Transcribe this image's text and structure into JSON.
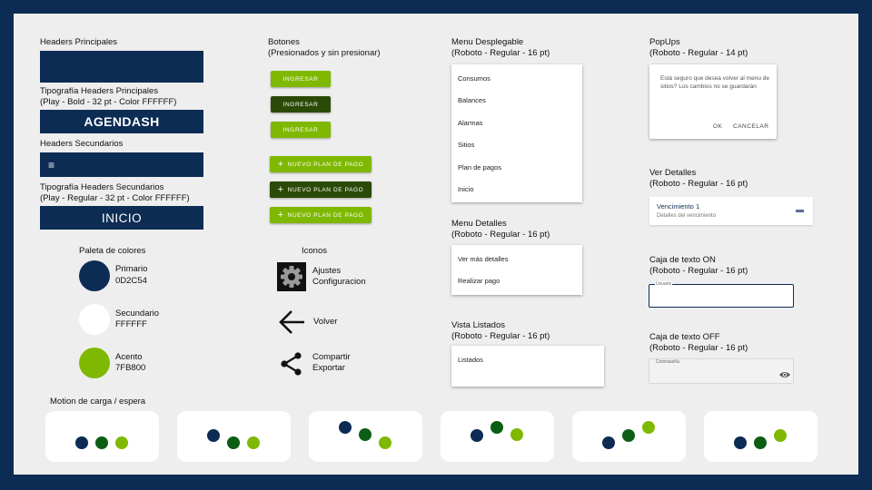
{
  "headers": {
    "principal_label": "Headers Principales",
    "principal_typo_label": "Tipografía Headers Principales\n(Play - Bold - 32 pt - Color FFFFFF)",
    "principal_sample": "AGENDASH",
    "secondary_label": "Headers Secundarios",
    "menu_icon": "≡",
    "secondary_typo_label": "Tipografía Headers Secundarios\n(Play - Regular - 32 pt - Color FFFFFF)",
    "secondary_sample": "INICIO"
  },
  "palette": {
    "label": "Paleta de colores",
    "colors": [
      {
        "name": "Primario",
        "hex_label": "0D2C54",
        "color": "#0D2C54"
      },
      {
        "name": "Secundario",
        "hex_label": "FFFFFF",
        "color": "#FFFFFF"
      },
      {
        "name": "Acento",
        "hex_label": "7FB800",
        "color": "#7FB800"
      }
    ]
  },
  "buttons": {
    "label": "Botones\n(Presionados y sin presionar)",
    "ingresar": "INGRESAR",
    "plus_symbol": "+",
    "nuevo_plan": "NUEVO PLAN DE PAGO"
  },
  "icons": {
    "label": "Iconos",
    "items": [
      {
        "icon": "gear-icon",
        "label": "Ajustes\nConfiguracion"
      },
      {
        "icon": "arrow-left-icon",
        "label": "Volver"
      },
      {
        "icon": "share-icon",
        "label": "Compartir\nExportar"
      }
    ]
  },
  "menu_desplegable": {
    "label": "Menu Desplegable\n(Roboto - Regular - 16 pt)",
    "items": [
      "Consumos",
      "Balances",
      "Alarmas",
      "Sitios",
      "Plan de pagos",
      "Inicio"
    ]
  },
  "menu_detalles": {
    "label": "Menu Detalles\n(Roboto - Regular - 16 pt)",
    "items": [
      "Ver más detalles",
      "Realizar pago"
    ]
  },
  "vista_listados": {
    "label": "Vista Listados\n(Roboto - Regular - 16 pt)",
    "item": "Listados"
  },
  "popups": {
    "label": "PopUps\n(Roboto - Regular - 14 pt)",
    "message": "Está seguro que desea volver al menu de sitios? Los cambios no se guardarán",
    "ok": "OK",
    "cancel": "CANCELAR"
  },
  "ver_detalles": {
    "label": "Ver Detalles\n(Roboto - Regular - 16 pt)",
    "title": "Vencimiento 1",
    "subtitle": "Detalles del vencimiento"
  },
  "caja_on": {
    "label": "Caja de texto ON\n(Roboto - Regular - 16 pt)",
    "field_label": "Usuario"
  },
  "caja_off": {
    "label": "Caja de texto OFF\n(Roboto - Regular - 16 pt)",
    "field_label": "Contraseña"
  },
  "motion": {
    "label": "Motion de carga / espera",
    "frames": 6
  },
  "colors": {
    "primary": "#0D2C54",
    "dark_green": "#0B5E14",
    "accent": "#7FB800",
    "pressed": "#2C4A07",
    "background": "#EEEEEE"
  }
}
